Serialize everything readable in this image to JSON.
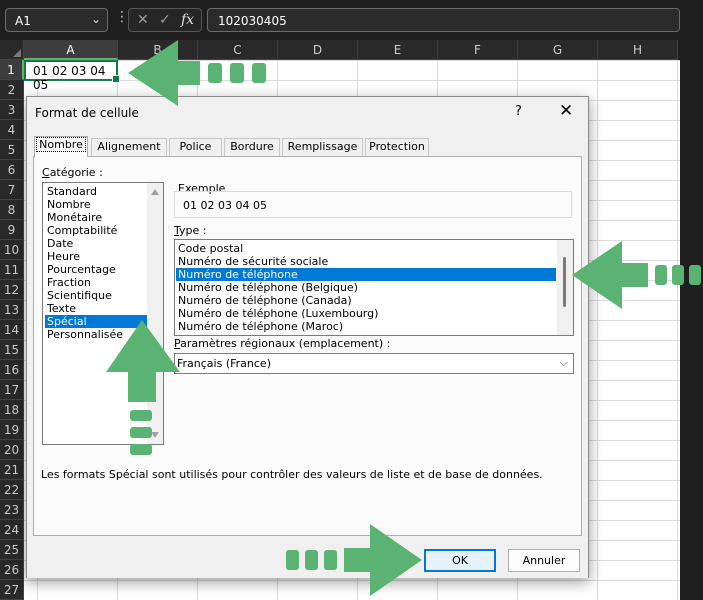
{
  "formula_bar": {
    "name_box": "A1",
    "cancel_glyph": "✕",
    "enter_glyph": "✓",
    "fx_label": "fx",
    "content": "102030405"
  },
  "sheet": {
    "columns": [
      "A",
      "B",
      "C",
      "D",
      "E",
      "F",
      "G",
      "H"
    ],
    "rows": [
      "1",
      "2",
      "3",
      "4",
      "5",
      "6",
      "7",
      "8",
      "9",
      "10",
      "11",
      "12",
      "13",
      "14",
      "15",
      "16",
      "17",
      "18",
      "19",
      "20",
      "21",
      "22",
      "23",
      "24",
      "25",
      "26",
      "27"
    ],
    "active_cell_value": "01 02 03 04 05"
  },
  "dialog": {
    "title": "Format de cellule",
    "help_glyph": "?",
    "close_glyph": "✕",
    "tabs": [
      "Nombre",
      "Alignement",
      "Police",
      "Bordure",
      "Remplissage",
      "Protection"
    ],
    "category_label": "Catégorie :",
    "categories": [
      "Standard",
      "Nombre",
      "Monétaire",
      "Comptabilité",
      "Date",
      "Heure",
      "Pourcentage",
      "Fraction",
      "Scientifique",
      "Texte",
      "Spécial",
      "Personnalisée"
    ],
    "selected_category": "Spécial",
    "example_label": "Exemple",
    "example_value": "01 02 03 04 05",
    "type_label": "Type :",
    "types": [
      "Code postal",
      "Numéro de sécurité sociale",
      "Numéro de téléphone",
      "Numéro de téléphone (Belgique)",
      "Numéro de téléphone (Canada)",
      "Numéro de téléphone (Luxembourg)",
      "Numéro de téléphone (Maroc)"
    ],
    "selected_type": "Numéro de téléphone",
    "locale_label": "Paramètres régionaux (emplacement) :",
    "locale_value": "Français (France)",
    "description": "Les formats Spécial sont utilisés pour contrôler des valeurs de liste et de base de données.",
    "ok_label": "OK",
    "cancel_label": "Annuler"
  },
  "colors": {
    "annotation_arrow": "#5bb373",
    "selection": "#0078d7",
    "excel_green": "#107c41"
  }
}
